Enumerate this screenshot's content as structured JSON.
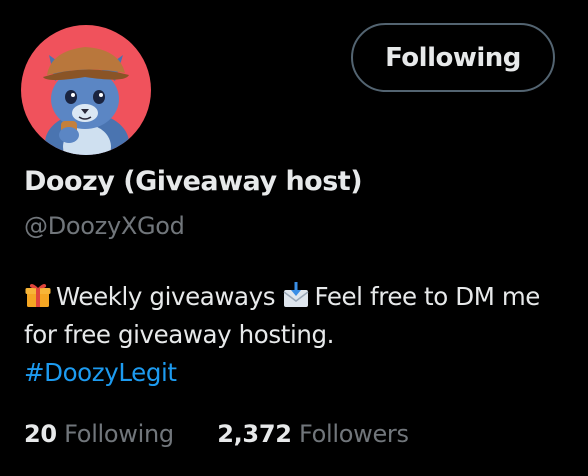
{
  "profile": {
    "avatar_icon": "cat-with-hat-avatar",
    "display_name": "Doozy (Giveaway host)",
    "handle": "@DoozyXGod",
    "follow_button_label": "Following",
    "bio": {
      "gift_emoji": "gift-icon",
      "part1": "Weekly giveaways",
      "envelope_emoji": "envelope-arrow-icon",
      "part2": "Feel free to DM me for free giveaway hosting.",
      "hashtag": "#DoozyLegit"
    },
    "stats": {
      "following_count": "20",
      "following_label": "Following",
      "followers_count": "2,372",
      "followers_label": "Followers"
    }
  },
  "colors": {
    "background": "#000000",
    "text_primary": "#e7e9ea",
    "text_secondary": "#71767b",
    "accent_link": "#1d9bf0",
    "button_border": "#536471",
    "avatar_bg": "#f0525c"
  }
}
